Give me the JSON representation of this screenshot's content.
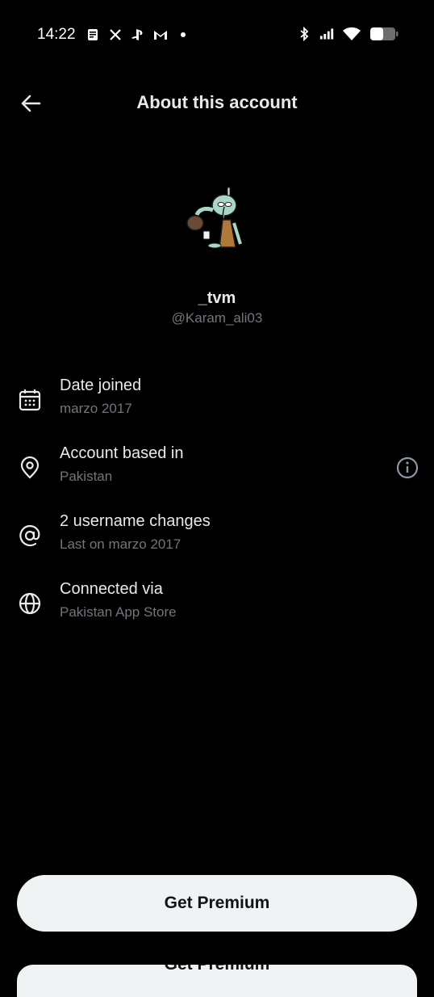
{
  "status_bar": {
    "time": "14:22",
    "left_icons": [
      "document-icon",
      "x-logo-icon",
      "playstation-icon",
      "gmail-icon",
      "dot-icon"
    ],
    "right_icons": [
      "bluetooth-icon",
      "signal-icon",
      "wifi-icon",
      "battery-icon"
    ]
  },
  "header": {
    "title": "About this account"
  },
  "profile": {
    "display_name": "_tvm",
    "handle": "@Karam_ali03",
    "avatar": "squidward-avatar"
  },
  "details": [
    {
      "icon": "calendar-icon",
      "title": "Date joined",
      "subtitle": "marzo 2017"
    },
    {
      "icon": "location-pin-icon",
      "title": "Account based in",
      "subtitle": "Pakistan"
    },
    {
      "icon": "at-sign-icon",
      "title": "2 username changes",
      "subtitle": "Last on marzo 2017"
    },
    {
      "icon": "globe-icon",
      "title": "Connected via",
      "subtitle": "Pakistan App Store"
    }
  ],
  "premium": {
    "label": "Get Premium"
  },
  "colors": {
    "background": "#000000",
    "primary_text": "#e7e9ea",
    "secondary_text": "#71767b",
    "button": "#eff3f4"
  }
}
